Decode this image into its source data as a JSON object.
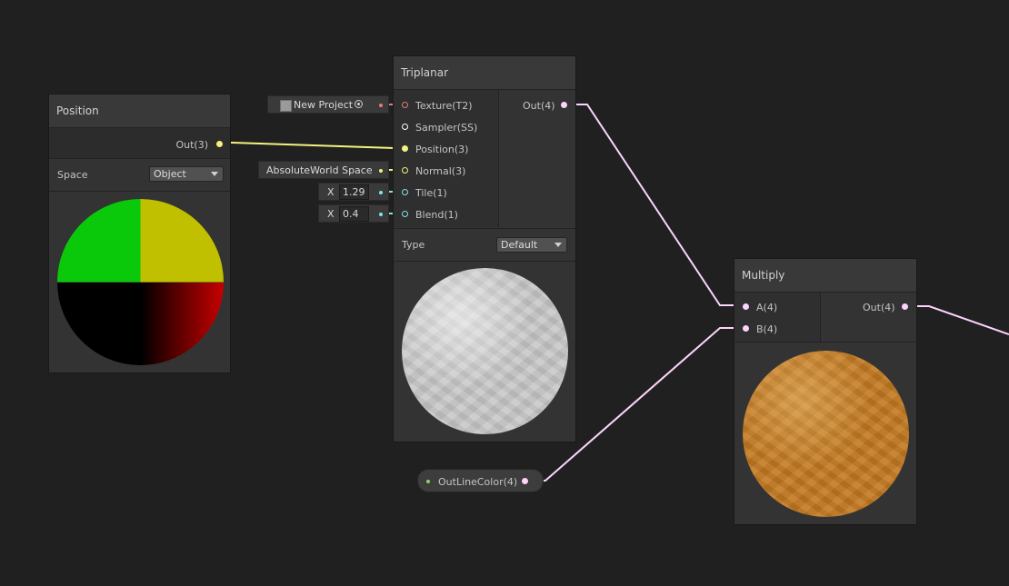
{
  "position_node": {
    "title": "Position",
    "output_label": "Out(3)",
    "space_label": "Space",
    "space_value": "Object"
  },
  "triplanar_node": {
    "title": "Triplanar",
    "inputs": [
      {
        "label": "Texture(T2)",
        "color": "#e57b7b"
      },
      {
        "label": "Sampler(SS)",
        "color": "#ffffff"
      },
      {
        "label": "Position(3)",
        "color": "#f4f27f"
      },
      {
        "label": "Normal(3)",
        "color": "#f4f27f"
      },
      {
        "label": "Tile(1)",
        "color": "#84e4e7"
      },
      {
        "label": "Blend(1)",
        "color": "#84e4e7"
      }
    ],
    "output_label": "Out(4)",
    "type_label": "Type",
    "type_value": "Default",
    "texture_field": "New Project",
    "normal_field": "AbsoluteWorld Space",
    "tile_axis": "X",
    "tile_value": "1.29",
    "blend_axis": "X",
    "blend_value": "0.4"
  },
  "multiply_node": {
    "title": "Multiply",
    "inputs": [
      {
        "label": "A(4)",
        "color": "#fcd4fc"
      },
      {
        "label": "B(4)",
        "color": "#fcd4fc"
      }
    ],
    "output_label": "Out(4)"
  },
  "property_node": {
    "label": "OutLineColor(4)",
    "color": "#fcd4fc"
  },
  "colors": {
    "background": "#202020",
    "wire_vector3": "#f4f27f",
    "wire_vector4": "#fcd4fc",
    "wire_vector1": "#84e4e7",
    "wire_texture": "#e57b7b"
  }
}
